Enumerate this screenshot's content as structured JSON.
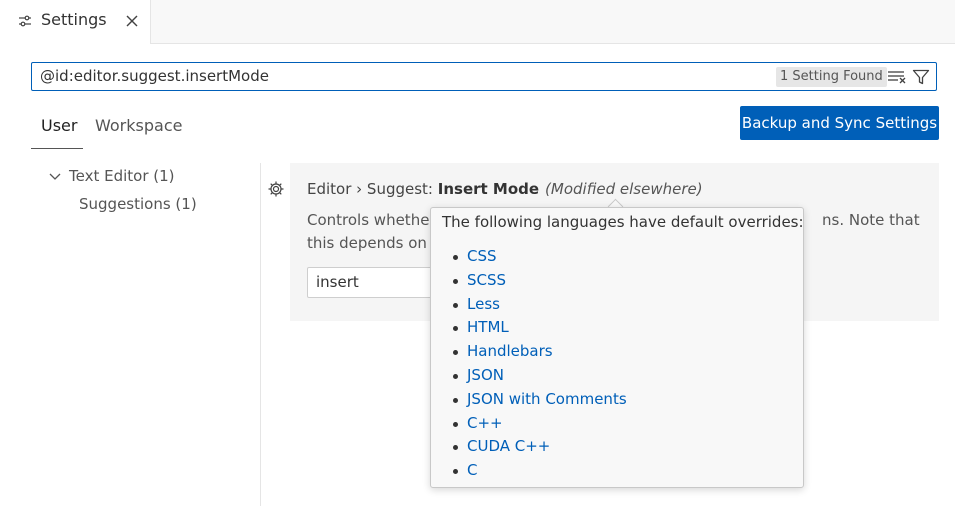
{
  "tab": {
    "title": "Settings"
  },
  "search": {
    "value": "@id:editor.suggest.insertMode",
    "badge": "1 Setting Found"
  },
  "scope_tabs": [
    {
      "label": "User",
      "active": true
    },
    {
      "label": "Workspace",
      "active": false
    }
  ],
  "sync_button": {
    "label": "Backup and Sync Settings"
  },
  "toc": [
    {
      "label": "Text Editor (1)",
      "expanded": true
    },
    {
      "label": "Suggestions (1)"
    }
  ],
  "setting": {
    "category": "Editor › Suggest: ",
    "name": "Insert Mode",
    "modified_note": "(Modified elsewhere)",
    "description_line1": "Controls whethe",
    "description_line1_end": "ns. Note that",
    "description_line2": "this depends on",
    "value": "insert"
  },
  "hover": {
    "heading": "The following languages have default overrides:",
    "languages": [
      "CSS",
      "SCSS",
      "Less",
      "HTML",
      "Handlebars",
      "JSON",
      "JSON with Comments",
      "C++",
      "CUDA C++",
      "C"
    ]
  },
  "colors": {
    "accent": "#005fb8",
    "card_background": "#f5f5f5"
  }
}
